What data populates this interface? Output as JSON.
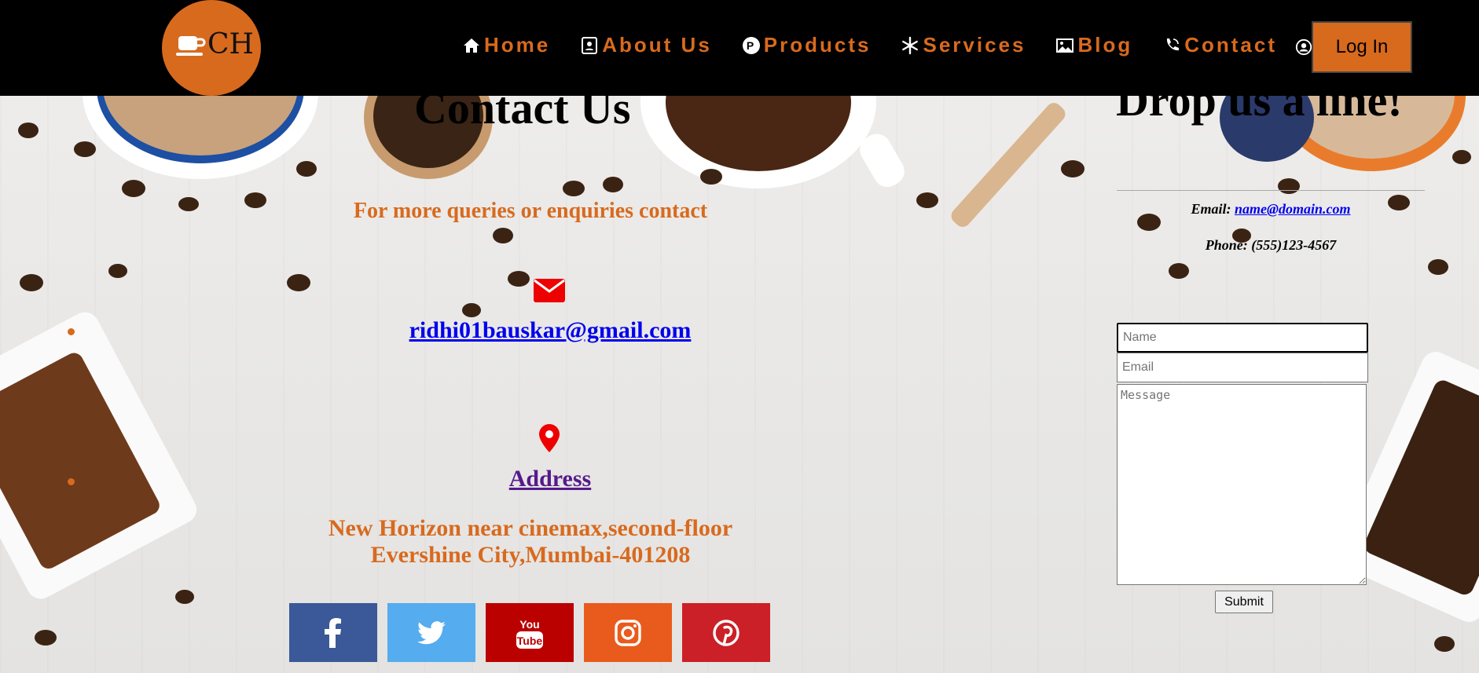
{
  "header": {
    "logo_text": "CH",
    "nav": [
      {
        "label": "Home",
        "icon": "home-icon"
      },
      {
        "label": "About Us",
        "icon": "id-card-icon"
      },
      {
        "label": "Products",
        "icon": "product-p-icon"
      },
      {
        "label": "Services",
        "icon": "snowflake-icon"
      },
      {
        "label": "Blog",
        "icon": "image-icon"
      },
      {
        "label": "Contact",
        "icon": "phone-icon"
      }
    ],
    "login_label": "Log In"
  },
  "contact": {
    "title": "Contact Us",
    "subtitle": "For more queries or enquiries contact",
    "email": "ridhi01bauskar@gmail.com",
    "address_heading": "Address",
    "address_line1": "New Horizon near cinemax,second-floor",
    "address_line2": "Evershine City,Mumbai-401208"
  },
  "social": [
    {
      "name": "facebook",
      "color": "#3b5998"
    },
    {
      "name": "twitter",
      "color": "#55acee"
    },
    {
      "name": "youtube",
      "color": "#bb0000"
    },
    {
      "name": "instagram",
      "color": "#e95b1c"
    },
    {
      "name": "pinterest",
      "color": "#cb2027"
    }
  ],
  "form": {
    "title": "Drop us a line!",
    "email_label": "Email:",
    "email_value": "name@domain.com",
    "phone_label": "Phone:",
    "phone_value": "(555)123-4567",
    "name_placeholder": "Name",
    "email_placeholder": "Email",
    "message_placeholder": "Message",
    "submit_label": "Submit"
  },
  "colors": {
    "accent": "#d86a1e",
    "header_bg": "#000000",
    "icon_red": "#ee0000"
  }
}
